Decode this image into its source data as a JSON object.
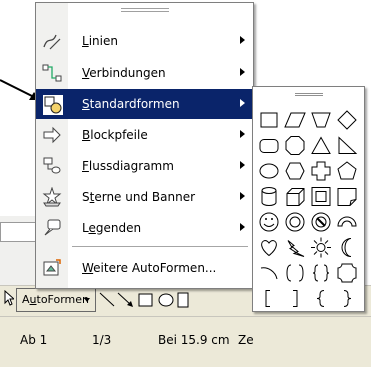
{
  "menu": {
    "items": [
      {
        "label": "Linien",
        "accel": "L",
        "icon": "lines-icon",
        "has_submenu": true
      },
      {
        "label": "Verbindungen",
        "accel": "V",
        "icon": "connectors-icon",
        "has_submenu": true
      },
      {
        "label": "Standardformen",
        "accel": "S",
        "icon": "basic-shapes-icon",
        "has_submenu": true,
        "selected": true
      },
      {
        "label": "Blockpfeile",
        "accel": "B",
        "icon": "block-arrows-icon",
        "has_submenu": true
      },
      {
        "label": "Flussdiagramm",
        "accel": "F",
        "icon": "flowchart-icon",
        "has_submenu": true
      },
      {
        "label": "Sterne und Banner",
        "accel": "t",
        "icon": "stars-banners-icon",
        "has_submenu": true
      },
      {
        "label": "Legenden",
        "accel": "e",
        "icon": "callouts-icon",
        "has_submenu": true
      },
      {
        "label": "Weitere AutoFormen...",
        "accel": "W",
        "icon": "more-autoshapes-icon",
        "has_submenu": false
      }
    ]
  },
  "submenu": {
    "shapes": [
      "rectangle-icon",
      "parallelogram-icon",
      "trapezoid-icon",
      "diamond-icon",
      "rounded-rectangle-icon",
      "octagon-icon",
      "isosceles-triangle-icon",
      "right-triangle-icon",
      "oval-icon",
      "hexagon-icon",
      "cross-icon",
      "pentagon-icon",
      "can-icon",
      "cube-icon",
      "bevel-icon",
      "folded-corner-icon",
      "smiley-face-icon",
      "donut-icon",
      "no-symbol-icon",
      "block-arc-icon",
      "heart-icon",
      "lightning-bolt-icon",
      "sun-icon",
      "moon-icon",
      "arc-icon",
      "double-bracket-icon",
      "double-brace-icon",
      "plaque-icon",
      "left-bracket-icon",
      "right-bracket-icon",
      "left-brace-icon",
      "right-brace-icon"
    ]
  },
  "drawbar": {
    "autoformen_label": "AutoFormen",
    "autoformen_accel": "u"
  },
  "statusbar": {
    "section": "Ab 1",
    "page": "1/3",
    "position": "Bei 15.9 cm",
    "line_partial": "Ze"
  },
  "colors": {
    "selection": "#0a246a",
    "menu_gutter": "#f1f1ef",
    "toolbar": "#ece9d8"
  }
}
